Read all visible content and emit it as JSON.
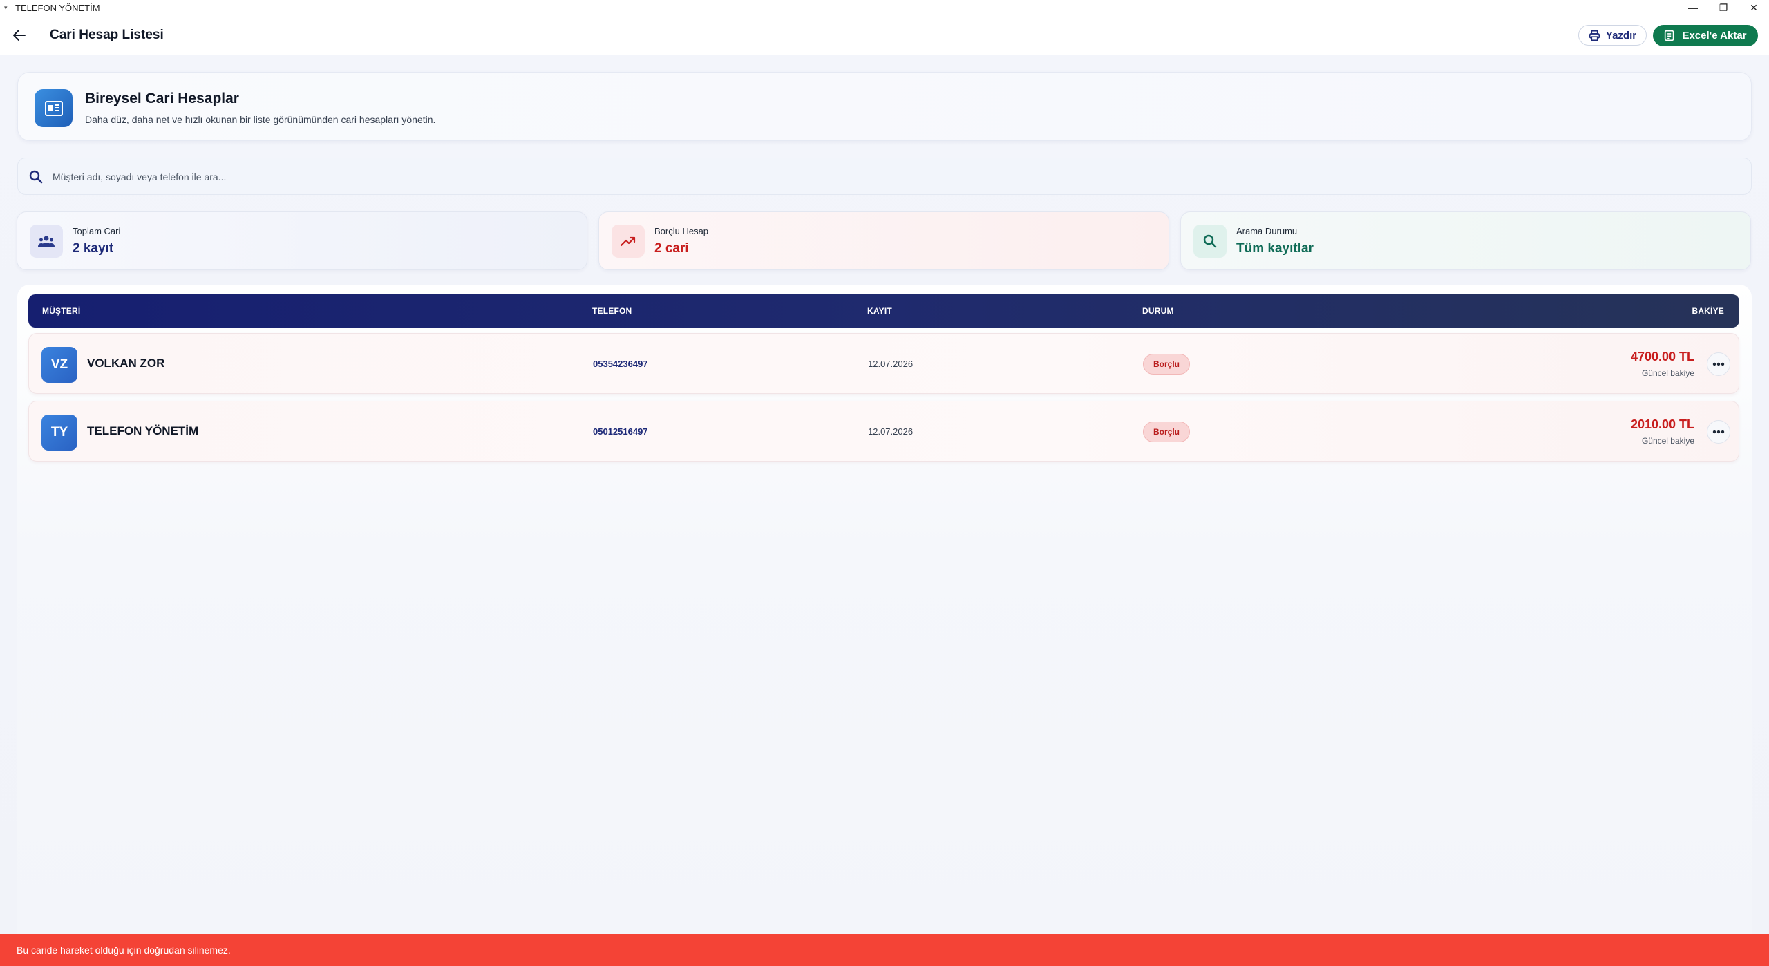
{
  "window": {
    "title": "TELEFON YÖNETİM",
    "controls": [
      "—",
      "❐",
      "✕"
    ]
  },
  "appbar": {
    "title": "Cari Hesap Listesi",
    "print_label": "Yazdır",
    "excel_label": "Excel'e Aktar"
  },
  "hero": {
    "title": "Bireysel Cari Hesaplar",
    "subtitle": "Daha düz, daha net ve hızlı okunan bir liste görünümünden cari hesapları yönetin."
  },
  "search": {
    "placeholder": "Müşteri adı, soyadı veya telefon ile ara..."
  },
  "stats": [
    {
      "label": "Toplam Cari",
      "value": "2 kayıt",
      "icon": "people-icon"
    },
    {
      "label": "Borçlu Hesap",
      "value": "2 cari",
      "icon": "trending-up-icon"
    },
    {
      "label": "Arama Durumu",
      "value": "Tüm kayıtlar",
      "icon": "search-icon"
    }
  ],
  "table": {
    "headers": [
      "MÜŞTERİ",
      "TELEFON",
      "KAYIT",
      "DURUM",
      "BAKİYE"
    ],
    "rows": [
      {
        "initials": "VZ",
        "name": "VOLKAN ZOR",
        "phone": "05354236497",
        "date": "12.07.2026",
        "status": "Borçlu",
        "balance": "4700.00 TL",
        "balance_caption": "Güncel bakiye"
      },
      {
        "initials": "TY",
        "name": "TELEFON YÖNETİM",
        "phone": "05012516497",
        "date": "12.07.2026",
        "status": "Borçlu",
        "balance": "2010.00 TL",
        "balance_caption": "Güncel bakiye"
      }
    ]
  },
  "snackbar": {
    "message": "Bu caride hareket olduğu için doğrudan silinemez."
  },
  "colors": {
    "primary_navy": "#1e2a78",
    "excel_green": "#0f7a4f",
    "debt_red": "#c81e1e",
    "snackbar_red": "#f44336"
  }
}
